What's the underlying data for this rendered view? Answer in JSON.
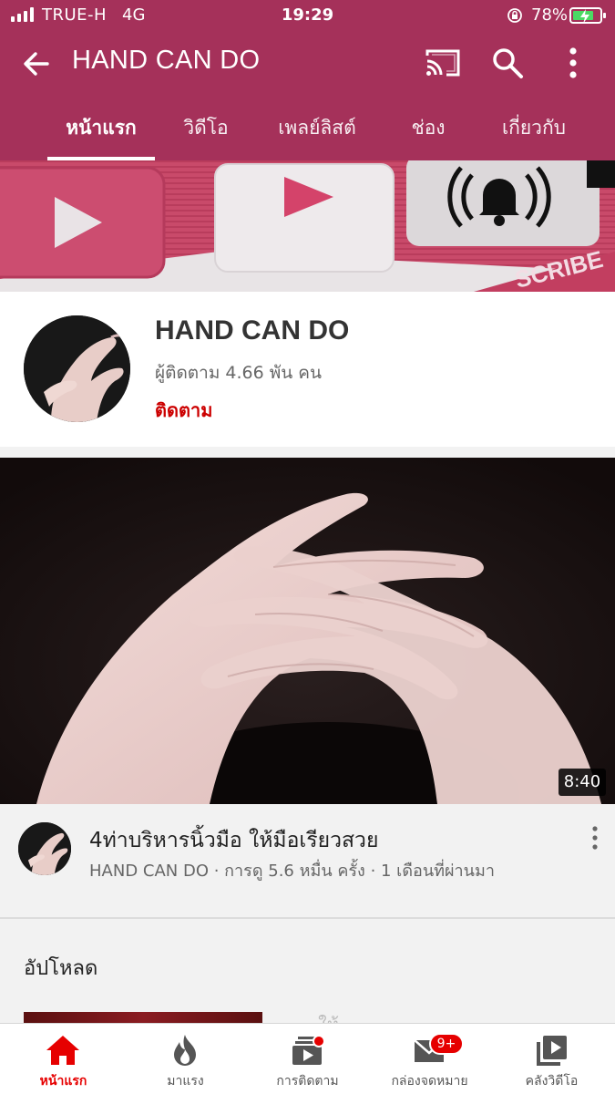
{
  "status_bar": {
    "carrier": "TRUE-H",
    "network": "4G",
    "time": "19:29",
    "battery_percent": "78%",
    "battery_level": 0.78
  },
  "app_bar": {
    "title": "HAND CAN DO",
    "icons": [
      "back-arrow-icon",
      "cast-icon",
      "search-icon",
      "more-vert-icon"
    ]
  },
  "tabs": [
    {
      "label": "หน้าแรก",
      "active": true
    },
    {
      "label": "วิดีโอ",
      "active": false
    },
    {
      "label": "เพลย์ลิสต์",
      "active": false
    },
    {
      "label": "ช่อง",
      "active": false
    },
    {
      "label": "เกี่ยวกับ",
      "active": false
    }
  ],
  "banner": {
    "watermark_text": "SCRIBE"
  },
  "channel": {
    "name": "HAND CAN DO",
    "subscribers": "ผู้ติดตาม 4.66 พัน คน",
    "subscribe_label": "ติดตาม"
  },
  "featured_video": {
    "duration": "8:40",
    "title": "4ท่าบริหารนิ้วมือ ให้มือเรียวสวย",
    "meta": "HAND CAN DO · การดู 5.6 หมื่น ครั้ง · 1 เดือนที่ผ่านมา"
  },
  "uploads": {
    "section_title": "อัปโหลด",
    "peek_title": "...ให้..."
  },
  "bottom_nav": [
    {
      "label": "หน้าแรก",
      "icon": "home-icon",
      "active": true
    },
    {
      "label": "มาแรง",
      "icon": "trending-icon",
      "active": false
    },
    {
      "label": "การติดตาม",
      "icon": "subscriptions-icon",
      "active": false
    },
    {
      "label": "กล่องจดหมาย",
      "icon": "inbox-icon",
      "active": false,
      "badge": "9+"
    },
    {
      "label": "คลังวิดีโอ",
      "icon": "library-icon",
      "active": false
    }
  ],
  "colors": {
    "header": "#a5315a",
    "accent_red": "#e60000",
    "subscribe_red": "#cc0000"
  }
}
